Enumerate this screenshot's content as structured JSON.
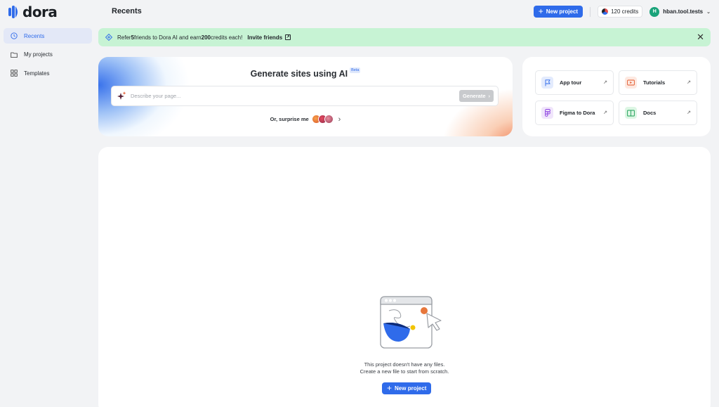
{
  "app": {
    "logo_text": "dora",
    "page_title": "Recents"
  },
  "topbar": {
    "new_project_label": "New project",
    "credits_label": "120 credits",
    "user_initial": "H",
    "user_name": "hban.tool.tests"
  },
  "sidebar": {
    "items": [
      {
        "label": "Recents",
        "icon": "clock-icon",
        "active": true
      },
      {
        "label": "My projects",
        "icon": "folder-icon",
        "active": false
      },
      {
        "label": "Templates",
        "icon": "grid-icon",
        "active": false
      }
    ]
  },
  "banner": {
    "text_pre": "Refer ",
    "text_count": "5",
    "text_mid": " friends to Dora AI and earn ",
    "text_credits": "200",
    "text_post": " credits each!",
    "invite_label": "Invite friends"
  },
  "generate": {
    "title": "Generate sites using AI",
    "beta": "Beta",
    "placeholder": "Describe your page...",
    "button_label": "Generate",
    "surprise_label": "Or, surprise me"
  },
  "quick_links": [
    {
      "label": "App tour",
      "icon": "flag-icon"
    },
    {
      "label": "Tutorials",
      "icon": "play-icon"
    },
    {
      "label": "Figma to Dora",
      "icon": "figma-icon"
    },
    {
      "label": "Docs",
      "icon": "book-icon"
    }
  ],
  "empty_state": {
    "line1": "This project doesn't have any files.",
    "line2": "Create a new file to start from scratch.",
    "button_label": "New project"
  },
  "colors": {
    "accent": "#2f6bea",
    "banner_bg": "#c7f3d4",
    "page_bg": "#f2f3f5"
  }
}
